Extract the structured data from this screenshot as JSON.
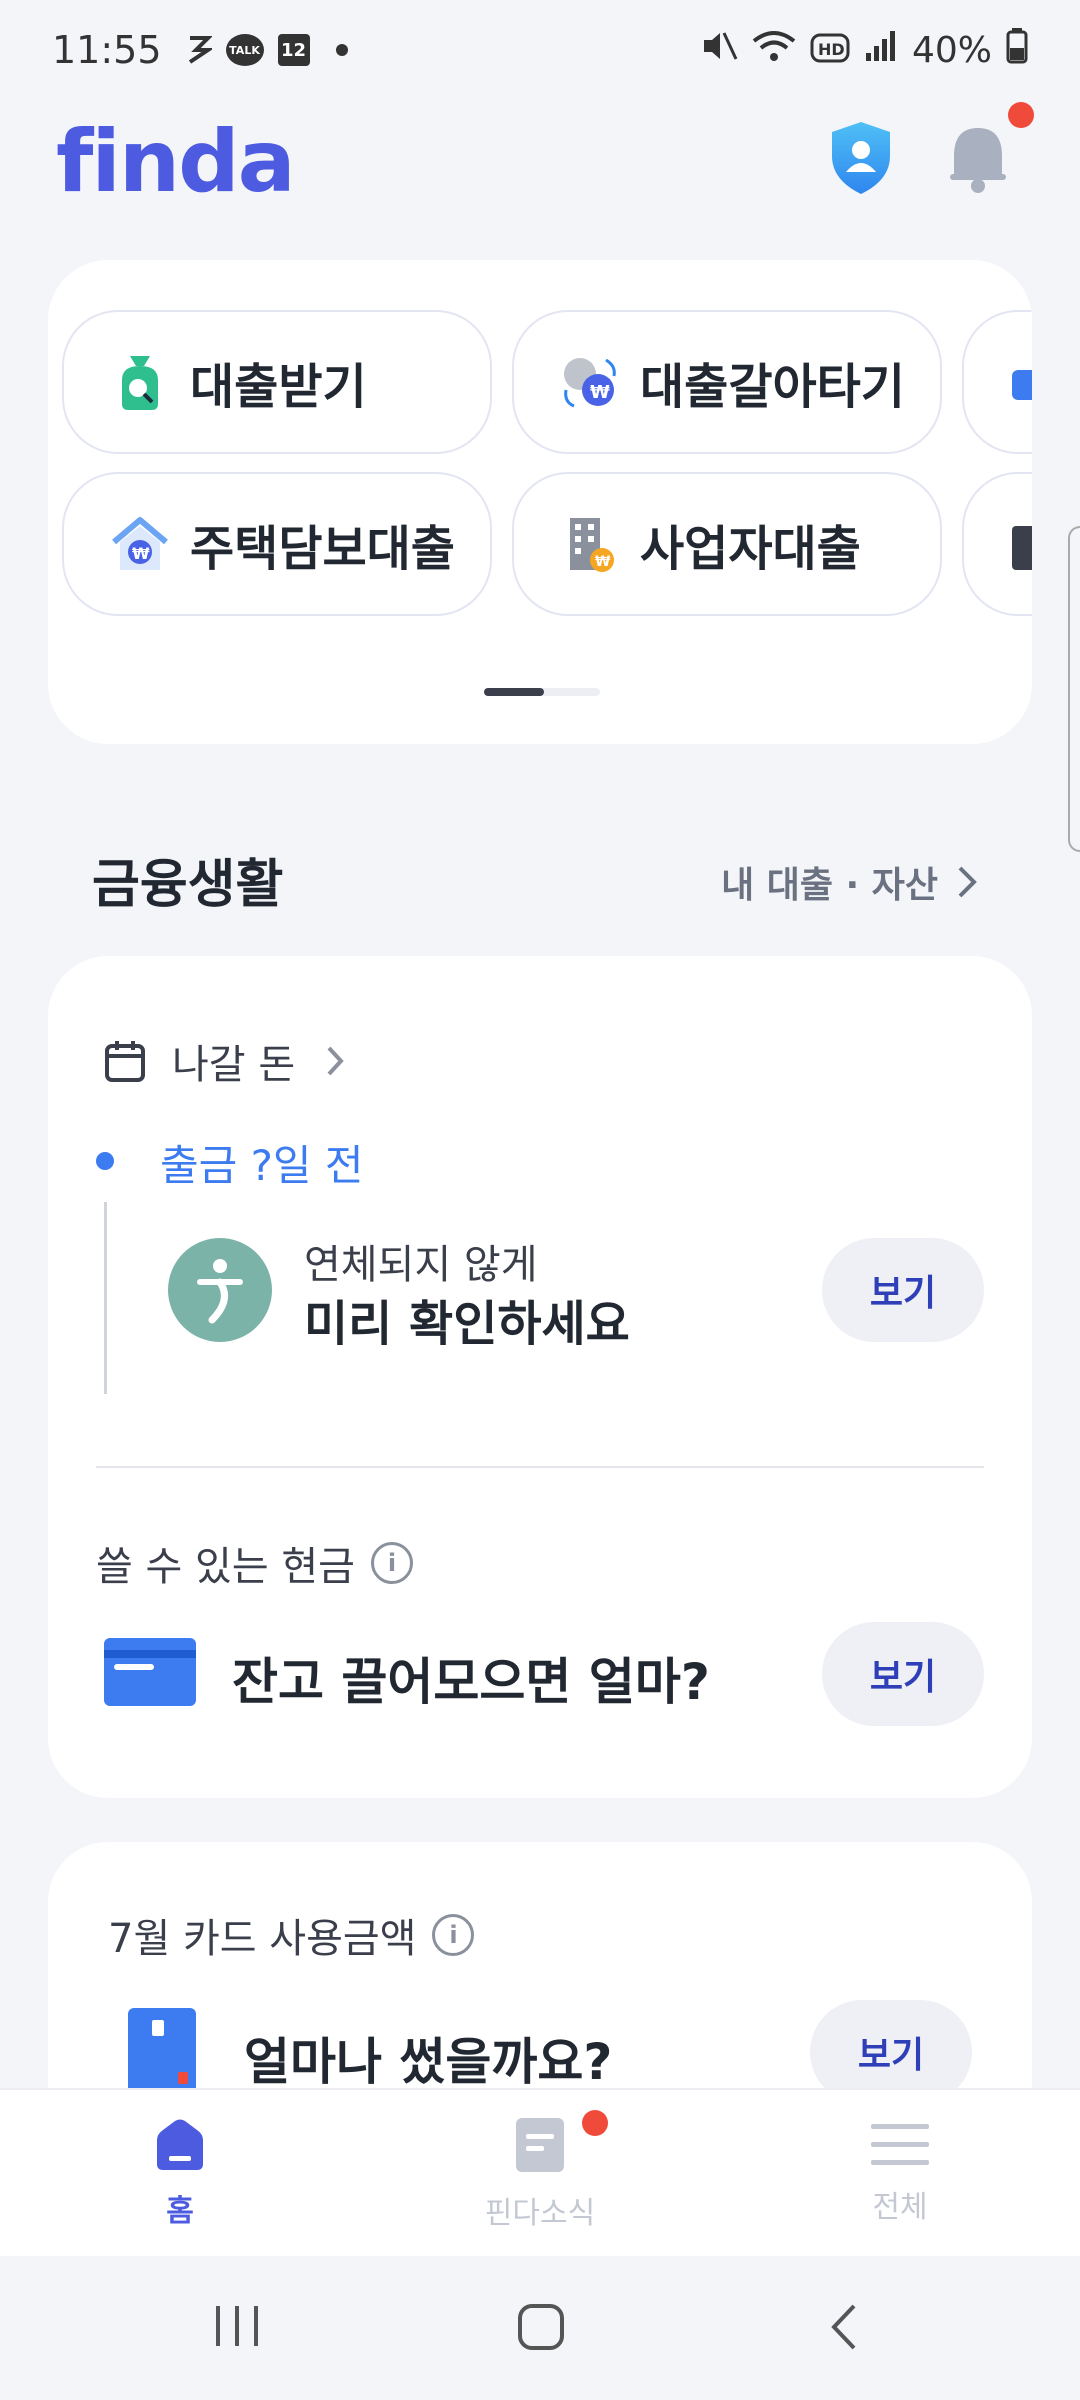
{
  "status_bar": {
    "time": "11:55",
    "talk_label": "TALK",
    "calendar_day": "12",
    "battery": "40%"
  },
  "header": {
    "logo": "finda",
    "brand_color": "#4c5be0",
    "notification_color": "#f04a3a"
  },
  "quick_menu": {
    "items": [
      {
        "label": "대출받기",
        "icon": "loan-search-icon"
      },
      {
        "label": "대출갈아타기",
        "icon": "loan-switch-icon"
      },
      {
        "label": "주택담보대출",
        "icon": "house-loan-icon"
      },
      {
        "label": "사업자대출",
        "icon": "business-loan-icon"
      }
    ]
  },
  "finance": {
    "title": "금융생활",
    "link": "내 대출 · 자산",
    "outgoing": {
      "label": "나갈 돈",
      "timeline": "출금 ?일 전",
      "sub": "연체되지 않게",
      "main": "미리 확인하세요",
      "button": "보기"
    },
    "cash": {
      "label": "쓸 수 있는 현금",
      "main": "잔고 끌어모으면 얼마?",
      "button": "보기"
    },
    "card_usage": {
      "label": "7월 카드 사용금액",
      "main": "얼마나 썼을까요?",
      "button": "보기"
    }
  },
  "bottom_nav": {
    "home": "홈",
    "news": "핀다소식",
    "all": "전체"
  }
}
